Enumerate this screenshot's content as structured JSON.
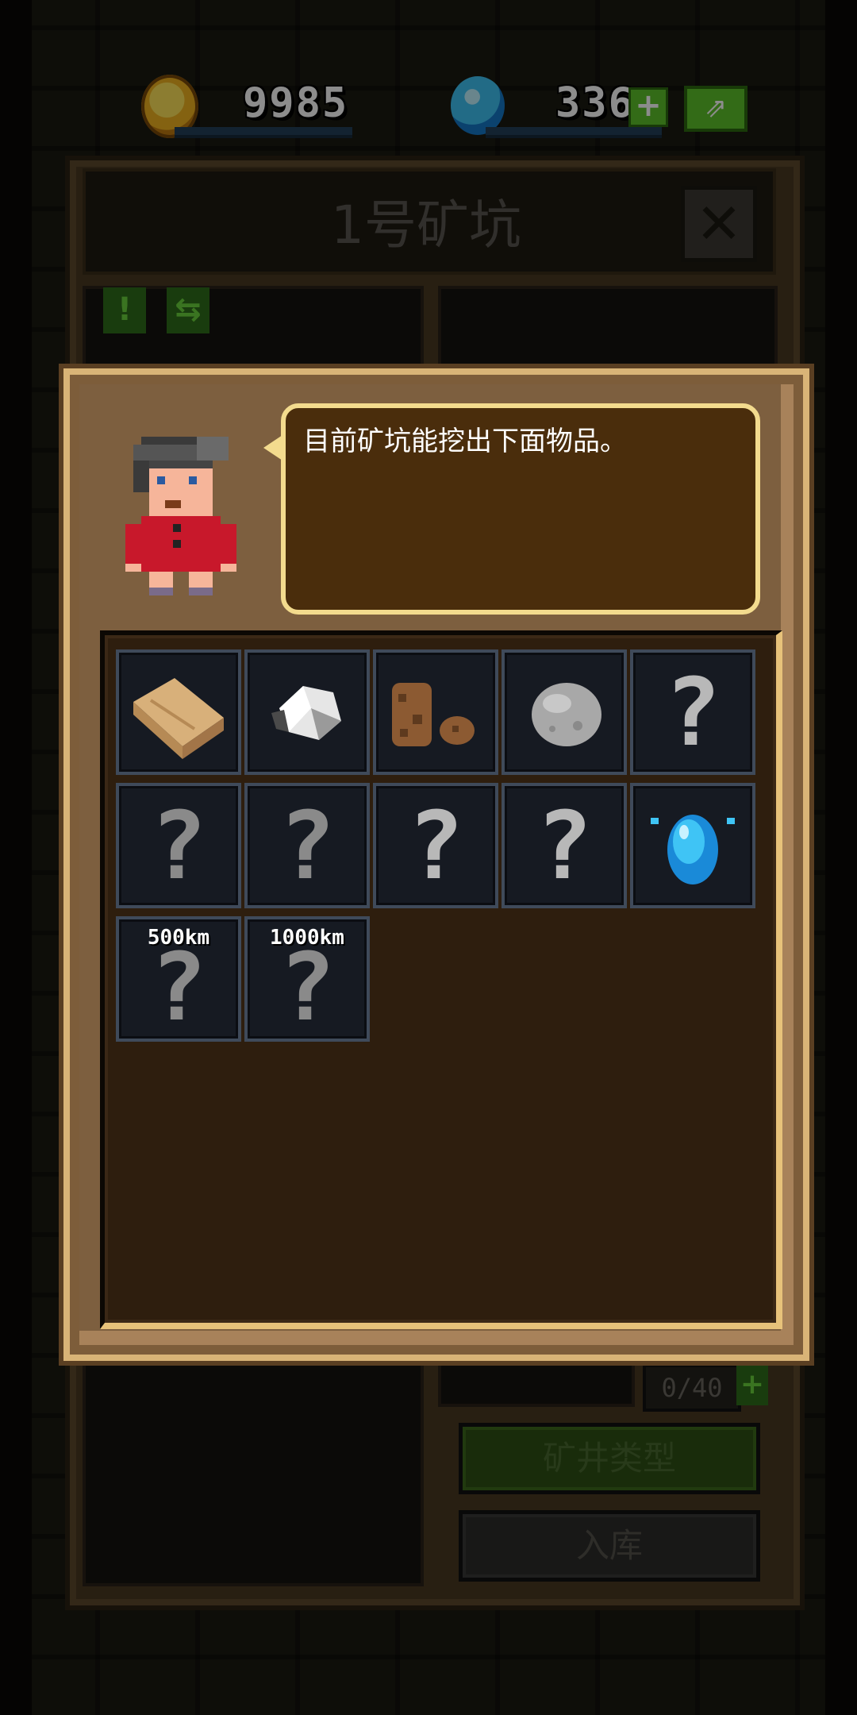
{
  "currency": {
    "coins": "9985",
    "gems": "336",
    "add_gems_label": "+",
    "share_label": "⇗"
  },
  "mine": {
    "title": "1号矿坑",
    "close_label": "✕",
    "counter": "0/40",
    "counter_plus": "+",
    "btn_type": "矿井类型",
    "btn_store": "入库",
    "tab_alert": "!",
    "tab_settings": "⇆"
  },
  "dialog": {
    "message": "目前矿坑能挖出下面物品。"
  },
  "items": [
    {
      "kind": "wood-plank-icon"
    },
    {
      "kind": "silver-ore-icon"
    },
    {
      "kind": "copper-ore-icon"
    },
    {
      "kind": "stone-icon"
    },
    {
      "kind": "unknown",
      "label": "?"
    },
    {
      "kind": "unknown",
      "label": "?"
    },
    {
      "kind": "unknown",
      "label": "?"
    },
    {
      "kind": "unknown",
      "label": "?"
    },
    {
      "kind": "unknown",
      "label": "?"
    },
    {
      "kind": "blue-gem-icon"
    },
    {
      "kind": "unknown",
      "label": "?",
      "depth": "500km"
    },
    {
      "kind": "unknown",
      "label": "?",
      "depth": "1000km"
    }
  ],
  "colors": {
    "coin": "#f0b320",
    "gem": "#3fc4f5",
    "green_button": "#5ec42a",
    "dialog_border": "#d9b477"
  }
}
